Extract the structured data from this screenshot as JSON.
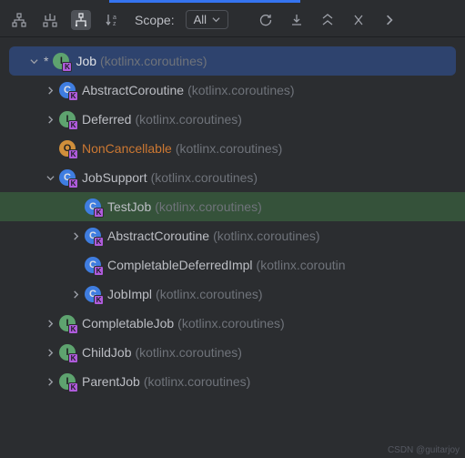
{
  "toolbar": {
    "scope_label": "Scope:",
    "scope_value": "All"
  },
  "tree": [
    {
      "indent": 0,
      "arrow": "expanded",
      "star": true,
      "icon": "interface",
      "name": "Job",
      "pkg": "(kotlinx.coroutines)",
      "selected": true
    },
    {
      "indent": 1,
      "arrow": "collapsed",
      "icon": "class-abstract",
      "name": "AbstractCoroutine",
      "pkg": "(kotlinx.coroutines)"
    },
    {
      "indent": 1,
      "arrow": "collapsed",
      "icon": "interface",
      "name": "Deferred",
      "pkg": "(kotlinx.coroutines)"
    },
    {
      "indent": 1,
      "arrow": "none",
      "icon": "object",
      "name": "NonCancellable",
      "pkg": "(kotlinx.coroutines)",
      "deprecated": true
    },
    {
      "indent": 1,
      "arrow": "expanded",
      "icon": "class",
      "name": "JobSupport",
      "pkg": "(kotlinx.coroutines)"
    },
    {
      "indent": 2,
      "arrow": "none",
      "icon": "class",
      "name": "TestJob",
      "pkg": "(kotlinx.coroutines)",
      "highlight": true
    },
    {
      "indent": 2,
      "arrow": "collapsed",
      "icon": "class-abstract",
      "name": "AbstractCoroutine",
      "pkg": "(kotlinx.coroutines)"
    },
    {
      "indent": 2,
      "arrow": "none",
      "icon": "class",
      "name": "CompletableDeferredImpl",
      "pkg": "(kotlinx.coroutin"
    },
    {
      "indent": 2,
      "arrow": "collapsed",
      "icon": "class",
      "name": "JobImpl",
      "pkg": "(kotlinx.coroutines)"
    },
    {
      "indent": 1,
      "arrow": "collapsed",
      "icon": "interface",
      "name": "CompletableJob",
      "pkg": "(kotlinx.coroutines)"
    },
    {
      "indent": 1,
      "arrow": "collapsed",
      "icon": "interface",
      "name": "ChildJob",
      "pkg": "(kotlinx.coroutines)"
    },
    {
      "indent": 1,
      "arrow": "collapsed",
      "icon": "interface",
      "name": "ParentJob",
      "pkg": "(kotlinx.coroutines)"
    }
  ],
  "watermark": "CSDN @guitarjoy"
}
